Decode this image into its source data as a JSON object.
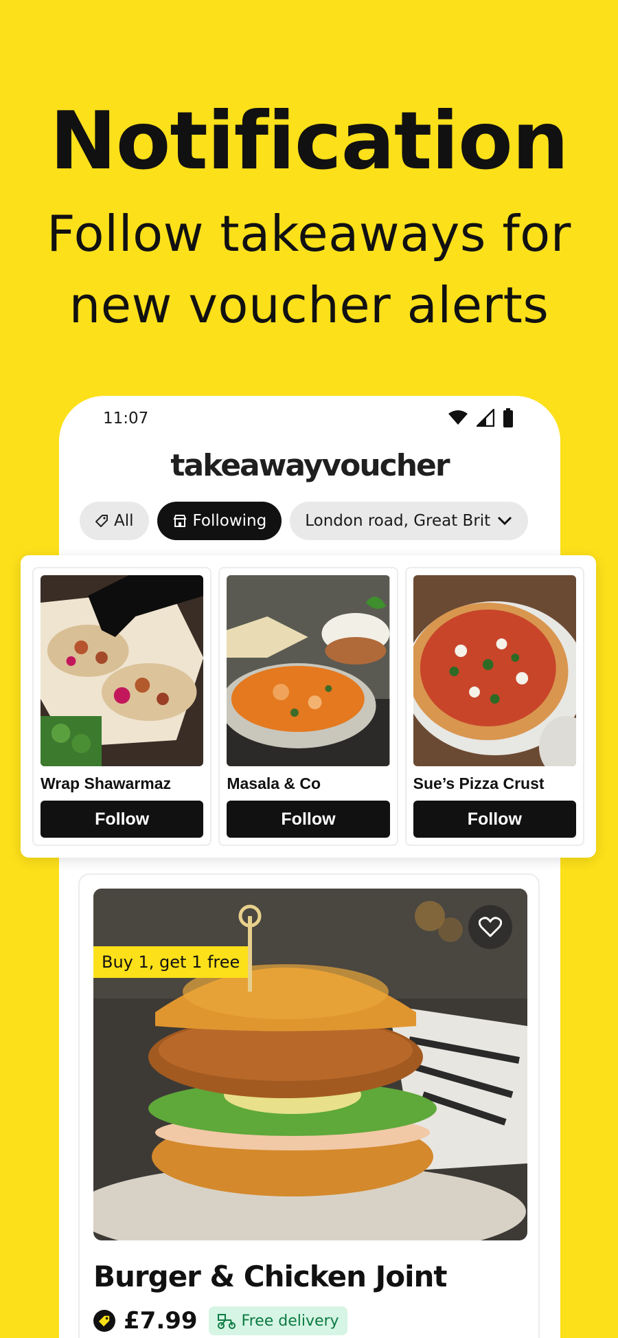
{
  "hero": {
    "title": "Notification",
    "subtitle_line1": "Follow takeaways for",
    "subtitle_line2": "new voucher alerts"
  },
  "status_bar": {
    "time": "11:07"
  },
  "app": {
    "logo": "takeawayvoucher"
  },
  "filters": {
    "all_label": "All",
    "following_label": "Following",
    "location_label": "London road, Great Brit"
  },
  "suggested_takeaways": [
    {
      "name": "Wrap Shawarmaz",
      "button": "Follow"
    },
    {
      "name": "Masala & Co",
      "button": "Follow"
    },
    {
      "name": "Sue’s Pizza Crust",
      "button": "Follow"
    }
  ],
  "deal": {
    "badge": "Buy 1, get 1 free",
    "name": "Burger & Chicken Joint",
    "price": "£7.99",
    "delivery": "Free delivery"
  },
  "colors": {
    "brand_yellow": "#FCE01A",
    "button_dark": "#111111",
    "delivery_green": "#0b7a43"
  }
}
